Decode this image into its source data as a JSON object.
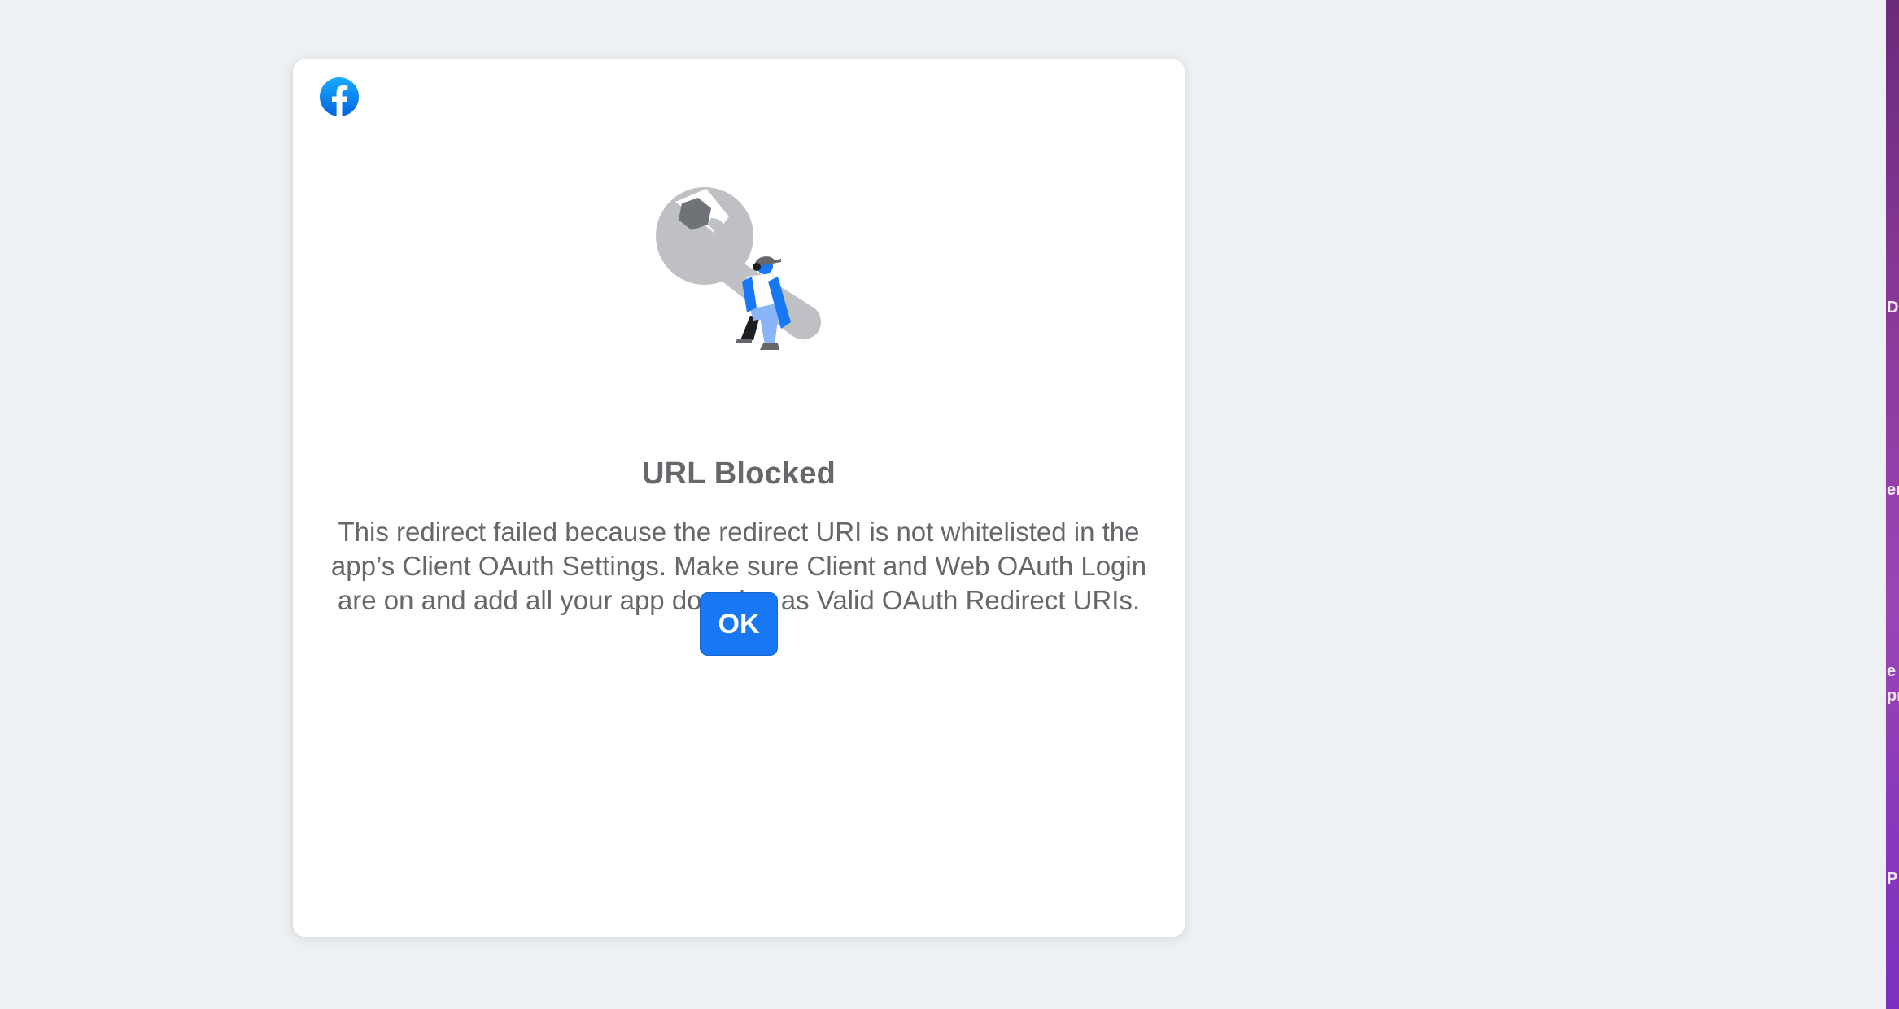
{
  "dialog": {
    "logo_icon": "facebook-logo-icon",
    "illustration_icon": "wrench-worker-illustration",
    "title": "URL Blocked",
    "message": "This redirect failed because the redirect URI is not whitelisted in the app’s Client OAuth Settings. Make sure Client and Web OAuth Login are on and add all your app domains as Valid OAuth Redirect URIs.",
    "ok_label": "OK"
  },
  "desktop_edge": {
    "fragments": [
      "D",
      "er",
      "e",
      "pr",
      "P"
    ]
  },
  "colors": {
    "page_background": "#eef1f4",
    "brand_blue": "#1877f2",
    "text_gray": "#65676b"
  }
}
